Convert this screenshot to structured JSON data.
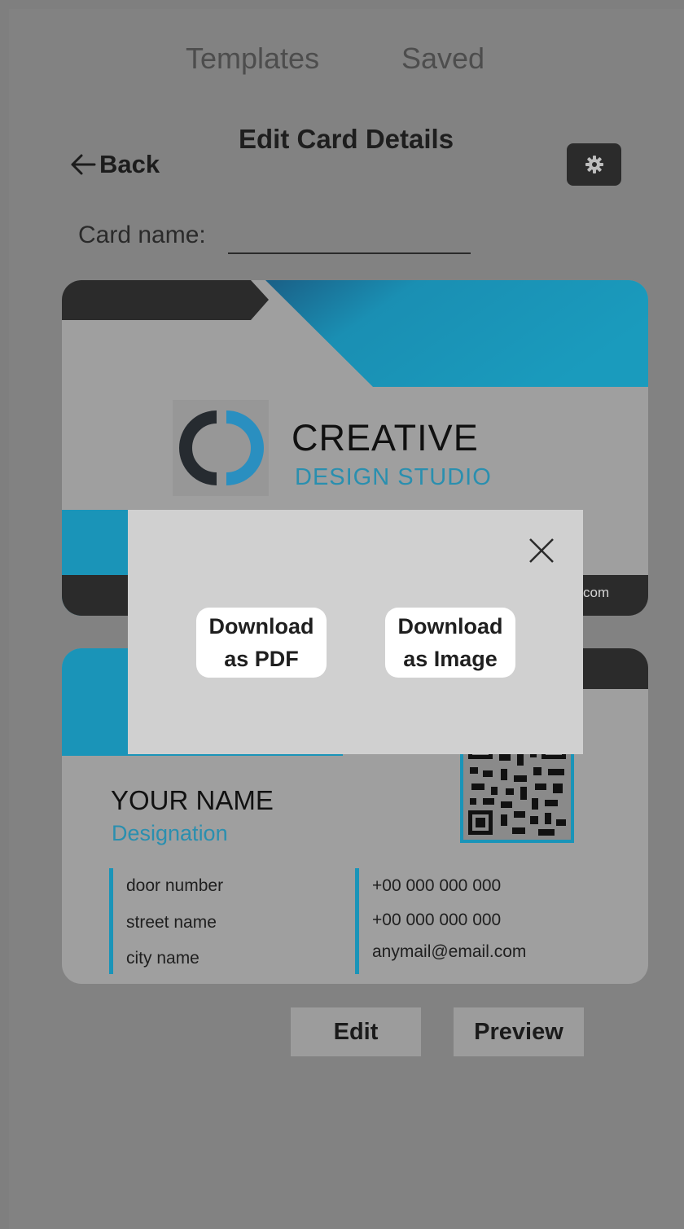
{
  "nav": {
    "templates": "Templates",
    "saved": "Saved"
  },
  "header": {
    "back": "Back",
    "title": "Edit Card Details"
  },
  "form": {
    "card_name_label": "Card name:",
    "card_name_value": ""
  },
  "card_front": {
    "brand_name": "CREATIVE",
    "brand_sub": "DESIGN STUDIO",
    "footer_partial": "com"
  },
  "card_back": {
    "name": "YOUR NAME",
    "designation": "Designation",
    "address": [
      "door number",
      "street name",
      "city name"
    ],
    "contacts": [
      "+00 000 000 000",
      "+00 000 000 000",
      "anymail@email.com"
    ]
  },
  "actions": {
    "edit": "Edit",
    "preview": "Preview"
  },
  "modal": {
    "pdf_line1": "Download",
    "pdf_line2": "as PDF",
    "image_line1": "Download",
    "image_line2": "as Image"
  },
  "colors": {
    "accent": "#1a94b8",
    "dark": "#2b2b2b",
    "overlay_bg": "#7f7f7f"
  }
}
